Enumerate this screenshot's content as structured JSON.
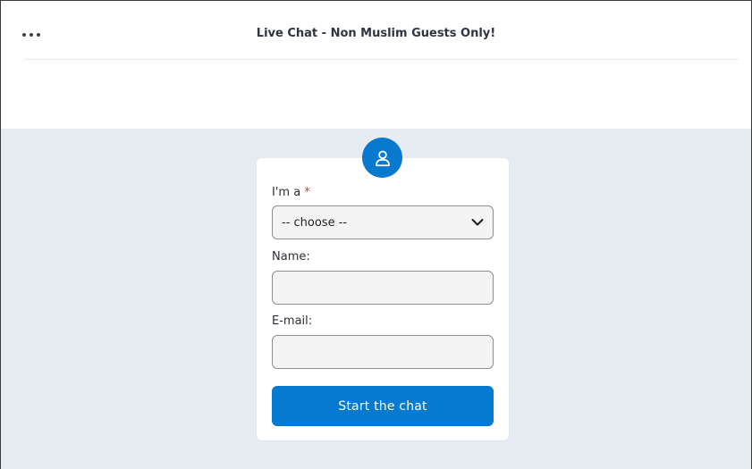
{
  "header": {
    "menu_icon": "more-horizontal-icon",
    "title": "Live Chat - Non Muslim Guests Only!"
  },
  "form": {
    "avatar_icon": "user-icon",
    "role_label": "I'm a",
    "required_marker": "*",
    "role_select_value": "-- choose --",
    "role_select_icon": "chevron-down-icon",
    "name_label": "Name:",
    "name_value": "",
    "email_label": "E-mail:",
    "email_value": "",
    "submit_label": "Start the chat"
  },
  "colors": {
    "accent": "#0679d1",
    "background": "#e7ecf3",
    "required": "#e0362e"
  }
}
